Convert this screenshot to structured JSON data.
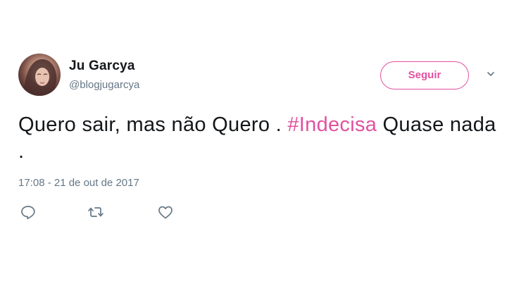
{
  "user": {
    "display_name": "Ju Garcya",
    "username": "@blogjugarcya"
  },
  "follow_button": {
    "label": "Seguir"
  },
  "tweet": {
    "text_before": "Quero sair, mas não Quero . ",
    "hashtag": "#Indecisa",
    "text_after": " Quase nada .",
    "timestamp": "17:08 - 21 de out de 2017"
  },
  "icons": {
    "more": "chevron-down-icon",
    "reply": "reply-icon",
    "retweet": "retweet-icon",
    "like": "heart-icon"
  },
  "colors": {
    "accent": "#e0529f",
    "text": "#14171a",
    "muted": "#657786"
  }
}
